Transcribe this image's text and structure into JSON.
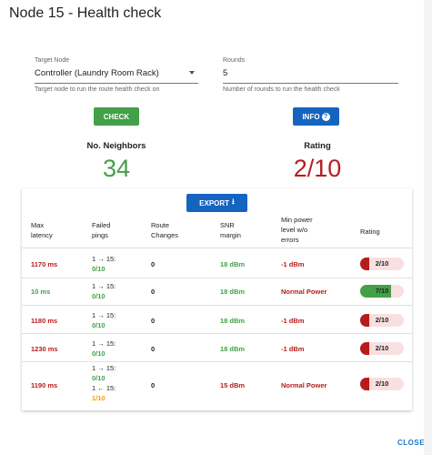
{
  "dialog": {
    "title": "Node 15 - Health check",
    "close_label": "CLOSE"
  },
  "form": {
    "target_node": {
      "label": "Target Node",
      "value": "Controller (Laundry Room Rack)",
      "help": "Target node to run the route health check on"
    },
    "rounds": {
      "label": "Rounds",
      "value": "5",
      "help": "Number of rounds to run the health check"
    }
  },
  "buttons": {
    "check": "CHECK",
    "info": "INFO",
    "info_icon": "?",
    "export": "EXPORT"
  },
  "stats": {
    "neighbors": {
      "label": "No. Neighbors",
      "value": "34"
    },
    "rating": {
      "label": "Rating",
      "value": "2/10"
    }
  },
  "colors": {
    "good": "#43a047",
    "bad": "#b71c1c",
    "warn": "#f59f00",
    "primary": "#1565c0"
  },
  "table": {
    "headers": {
      "latency": [
        "Max",
        "latency"
      ],
      "pings": [
        "Failed",
        "pings"
      ],
      "route": [
        "Route",
        "Changes"
      ],
      "snr": [
        "SNR",
        "margin"
      ],
      "power": [
        "Min power",
        "level w/o",
        "errors"
      ],
      "rating": "Rating"
    },
    "rows": [
      {
        "latency": "1170 ms",
        "pings": [
          {
            "route": "1 → 15:",
            "count": "0/10"
          }
        ],
        "route_changes": "0",
        "snr": "18 dBm",
        "power": "-1 dBm",
        "rating": "2/10",
        "rating_value": 2
      },
      {
        "latency": "10 ms",
        "pings": [
          {
            "route": "1 → 15:",
            "count": "0/10"
          }
        ],
        "route_changes": "0",
        "snr": "18 dBm",
        "power": "Normal Power",
        "rating": "7/10",
        "rating_value": 7
      },
      {
        "latency": "1180 ms",
        "pings": [
          {
            "route": "1 → 15:",
            "count": "0/10"
          }
        ],
        "route_changes": "0",
        "snr": "18 dBm",
        "power": "-1 dBm",
        "rating": "2/10",
        "rating_value": 2
      },
      {
        "latency": "1230 ms",
        "pings": [
          {
            "route": "1 → 15:",
            "count": "0/10"
          }
        ],
        "route_changes": "0",
        "snr": "18 dBm",
        "power": "-1 dBm",
        "rating": "2/10",
        "rating_value": 2
      },
      {
        "latency": "1190 ms",
        "pings": [
          {
            "route": "1 → 15:",
            "count": "0/10"
          },
          {
            "route": "1 ← 15:",
            "count": "1/10"
          }
        ],
        "route_changes": "0",
        "snr": "15 dBm",
        "power": "Normal Power",
        "rating": "2/10",
        "rating_value": 2
      }
    ]
  }
}
